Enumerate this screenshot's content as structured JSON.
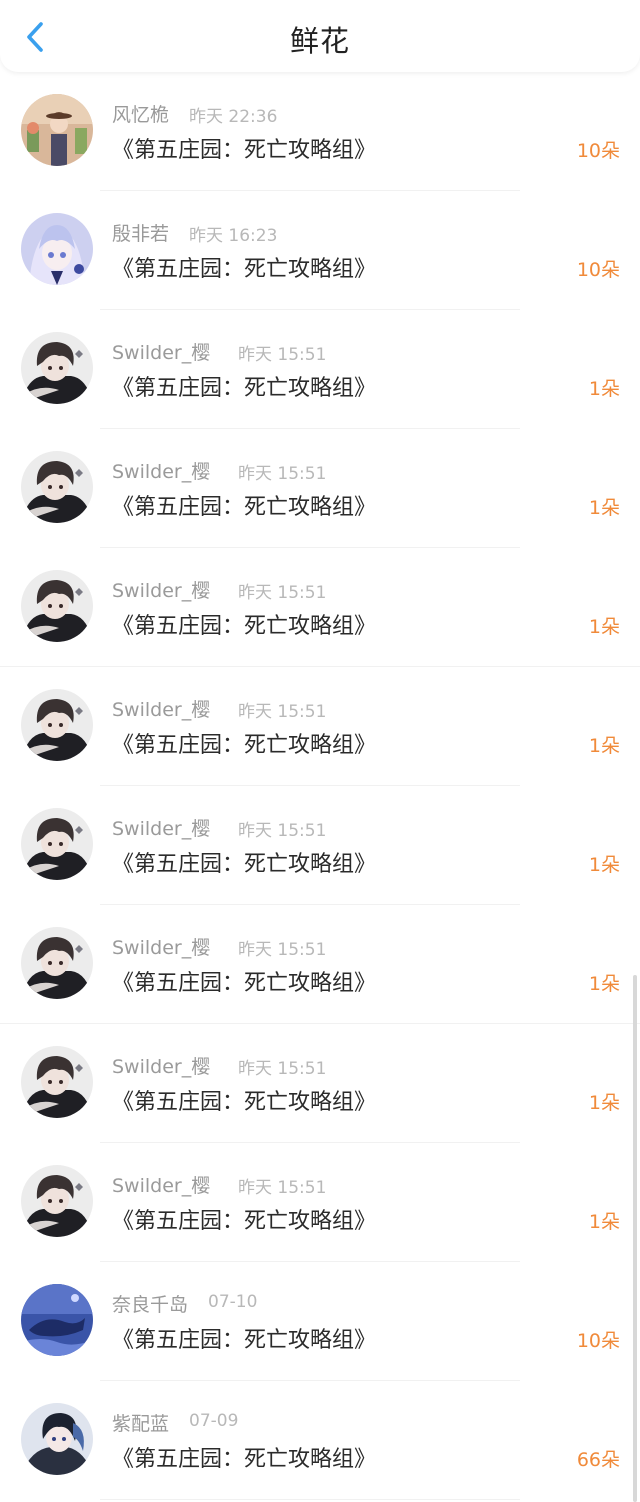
{
  "header": {
    "title": "鲜花",
    "back_icon": "chevron-left-icon",
    "accent": "#3aa0ee"
  },
  "count_color": "#f08a3a",
  "records": [
    {
      "user": "风忆桅",
      "time": "昨天 22:36",
      "book": "《第五庄园：死亡攻略组》",
      "count": "10朵",
      "avatar": "girl-hat"
    },
    {
      "user": "殷非若",
      "time": "昨天 16:23",
      "book": "《第五庄园：死亡攻略组》",
      "count": "10朵",
      "avatar": "girl-lavender"
    },
    {
      "user": "Swilder_樱",
      "time": "昨天 15:51",
      "book": "《第五庄园：死亡攻略组》",
      "count": "1朵",
      "avatar": "boy-dark"
    },
    {
      "user": "Swilder_樱",
      "time": "昨天 15:51",
      "book": "《第五庄园：死亡攻略组》",
      "count": "1朵",
      "avatar": "boy-dark"
    },
    {
      "user": "Swilder_樱",
      "time": "昨天 15:51",
      "book": "《第五庄园：死亡攻略组》",
      "count": "1朵",
      "avatar": "boy-dark"
    },
    {
      "user": "Swilder_樱",
      "time": "昨天 15:51",
      "book": "《第五庄园：死亡攻略组》",
      "count": "1朵",
      "avatar": "boy-dark"
    },
    {
      "user": "Swilder_樱",
      "time": "昨天 15:51",
      "book": "《第五庄园：死亡攻略组》",
      "count": "1朵",
      "avatar": "boy-dark"
    },
    {
      "user": "Swilder_樱",
      "time": "昨天 15:51",
      "book": "《第五庄园：死亡攻略组》",
      "count": "1朵",
      "avatar": "boy-dark"
    },
    {
      "user": "Swilder_樱",
      "time": "昨天 15:51",
      "book": "《第五庄园：死亡攻略组》",
      "count": "1朵",
      "avatar": "boy-dark"
    },
    {
      "user": "Swilder_樱",
      "time": "昨天 15:51",
      "book": "《第五庄园：死亡攻略组》",
      "count": "1朵",
      "avatar": "boy-dark"
    },
    {
      "user": "奈良千岛",
      "time": "07-10",
      "book": "《第五庄园：死亡攻略组》",
      "count": "10朵",
      "avatar": "blue-whale"
    },
    {
      "user": "紫配蓝",
      "time": "07-09",
      "book": "《第五庄园：死亡攻略组》",
      "count": "66朵",
      "avatar": "boy-blue"
    }
  ]
}
